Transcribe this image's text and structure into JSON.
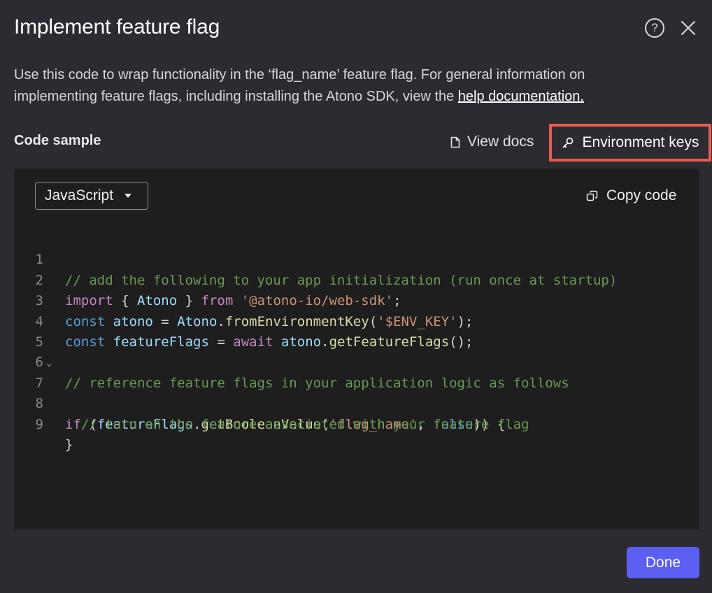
{
  "dialog": {
    "title": "Implement feature flag",
    "description_before_link": "Use this code to wrap functionality in the ‘flag_name’ feature flag. For general information on implementing feature flags, including installing the Atono SDK, view the ",
    "description_link": "help documentation.",
    "help_icon_glyph": "?",
    "icons": {
      "help": "question-circle-icon",
      "close": "close-icon",
      "view_docs": "document-icon",
      "env_keys": "key-icon",
      "copy": "copy-icon",
      "dropdown": "caret-down-icon",
      "fold": "chevron-down-icon"
    }
  },
  "code_section": {
    "label": "Code sample",
    "view_docs_label": "View docs",
    "env_keys_label": "Environment keys",
    "language_selected": "JavaScript",
    "copy_label": "Copy code",
    "line_numbers": [
      "1",
      "2",
      "3",
      "4",
      "5",
      "6",
      "7",
      "8",
      "9"
    ],
    "fold_marker": "⌄",
    "lines": {
      "l1": "// add the following to your app initialization (run once at startup)",
      "l2": {
        "import": "import",
        "open": " { ",
        "name": "Atono",
        "close": " } ",
        "from": "from",
        "sp": " ",
        "pkg": "'@atono-io/web-sdk'",
        "end": ";"
      },
      "l3": {
        "const": "const",
        "sp1": " ",
        "var": "atono",
        "eq": " = ",
        "cls": "Atono",
        "dot": ".",
        "fn": "fromEnvironmentKey",
        "open": "(",
        "arg": "'$ENV_KEY'",
        "end": ");"
      },
      "l4": {
        "const": "const",
        "sp1": " ",
        "var": "featureFlags",
        "eq": " = ",
        "await": "await",
        "sp2": " ",
        "obj": "atono",
        "dot": ".",
        "fn": "getFeatureFlags",
        "end": "();"
      },
      "l6": "// reference feature flags in your application logic as follows",
      "l7": {
        "if": "if",
        "open": " (",
        "obj": "featureFlags",
        "dot": ".",
        "fn": "getBooleanValue",
        "p": "(",
        "arg": "'flag_name'",
        "comma": ", ",
        "bool": "false",
        "end": ")) {"
      },
      "l8": "  // turn on the feature associated with your feature flag",
      "l9": "}"
    }
  },
  "footer": {
    "done_label": "Done"
  },
  "colors": {
    "background": "#2c2b31",
    "code_background": "#1e1e1e",
    "highlight_border": "#ea5b4b",
    "primary_button": "#5b5ff2"
  }
}
